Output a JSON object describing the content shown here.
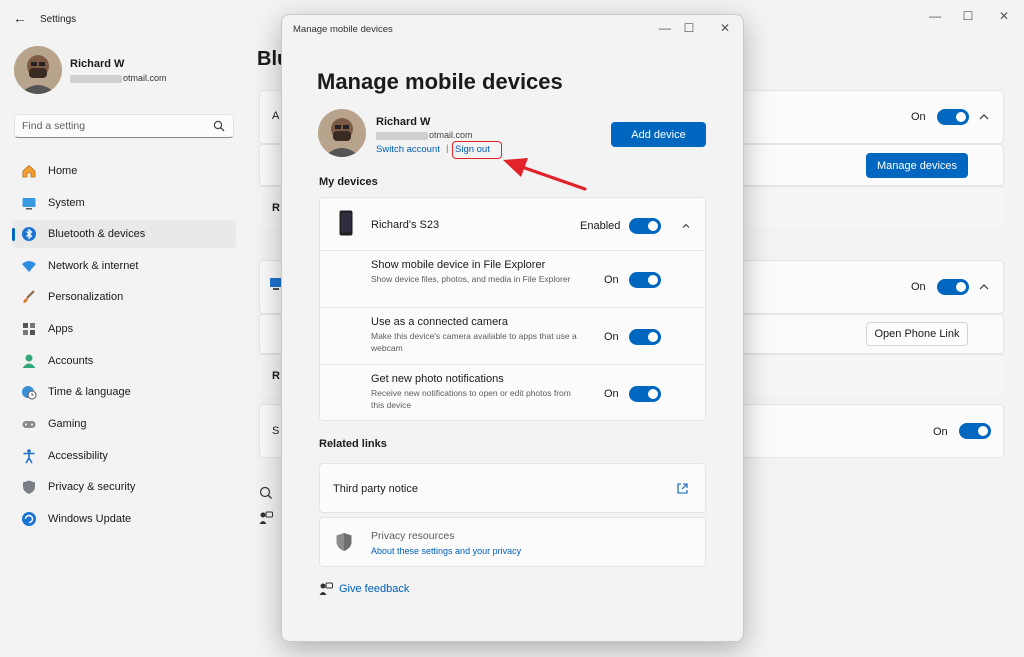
{
  "settings": {
    "title": "Settings",
    "profile": {
      "name": "Richard W",
      "email_visible": "otmail.com"
    },
    "search": {
      "placeholder": "Find a setting"
    },
    "nav": [
      {
        "label": "Home",
        "icon": "home-icon"
      },
      {
        "label": "System",
        "icon": "system-icon"
      },
      {
        "label": "Bluetooth & devices",
        "icon": "bluetooth-icon",
        "active": true
      },
      {
        "label": "Network & internet",
        "icon": "wifi-icon"
      },
      {
        "label": "Personalization",
        "icon": "brush-icon"
      },
      {
        "label": "Apps",
        "icon": "apps-icon"
      },
      {
        "label": "Accounts",
        "icon": "person-icon"
      },
      {
        "label": "Time & language",
        "icon": "globe-clock-icon"
      },
      {
        "label": "Gaming",
        "icon": "gamepad-icon"
      },
      {
        "label": "Accessibility",
        "icon": "accessibility-icon"
      },
      {
        "label": "Privacy & security",
        "icon": "shield-icon"
      },
      {
        "label": "Windows Update",
        "icon": "update-icon"
      }
    ],
    "content": {
      "heading_partial": "Blu",
      "card1_on": "On",
      "manage_devices_button": "Manage devices",
      "card2_on": "On",
      "open_phone_link_button": "Open Phone Link",
      "card3_on": "On",
      "fragment_a": "A",
      "fragment_r1": "R",
      "fragment_r2": "R",
      "fragment_s": "S"
    }
  },
  "dialog": {
    "title": "Manage mobile devices",
    "heading": "Manage mobile devices",
    "account": {
      "name": "Richard W",
      "email_visible": "otmail.com",
      "switch_account": "Switch account",
      "separator": "|",
      "sign_out": "Sign out"
    },
    "add_device_button": "Add device",
    "my_devices_label": "My devices",
    "device": {
      "name": "Richard's S23",
      "status": "Enabled",
      "options": [
        {
          "title": "Show mobile device in File Explorer",
          "description": "Show device files, photos, and media in File Explorer",
          "state": "On"
        },
        {
          "title": "Use as a connected camera",
          "description": "Make this device's camera available to apps that use a webcam",
          "state": "On"
        },
        {
          "title": "Get new photo notifications",
          "description": "Receive new notifications to open or edit photos from this device",
          "state": "On"
        }
      ]
    },
    "related_links_label": "Related links",
    "third_party_notice": "Third party notice",
    "privacy": {
      "title": "Privacy resources",
      "link": "About these settings and your privacy"
    },
    "give_feedback": "Give feedback"
  },
  "colors": {
    "accent": "#0067c0",
    "link": "#005fb8",
    "annotation_red": "#e2232a"
  }
}
